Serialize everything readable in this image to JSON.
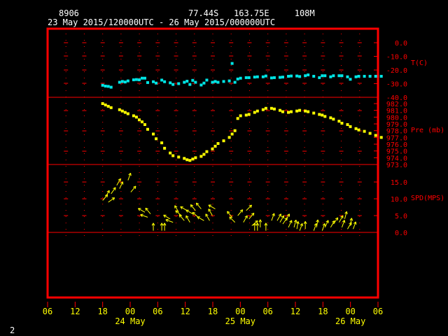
{
  "header": {
    "station_id": "8906",
    "location": "77.44S   163.75E     108M",
    "period": "23 May 2015/120000UTC - 26 May 2015/000000UTC"
  },
  "footer": {
    "page_number": "2"
  },
  "colors": {
    "frame": "#ff0000",
    "text_labels": "#ff0000",
    "header_text": "#ffffff",
    "temperature": "#00e5e5",
    "pressure": "#ffff00",
    "wind": "#ffff00"
  },
  "chart_data": [
    {
      "type": "scatter",
      "name": "temperature",
      "ylabel": "T(C)",
      "ylim": [
        -40,
        10
      ],
      "yticks": [
        0,
        -10,
        -20,
        -30,
        -40
      ],
      "ytick_labels": [
        "0.0",
        "-10.0",
        "-20.0",
        "-30.0",
        "-40.0"
      ],
      "x_hours": [
        0,
        1,
        2,
        3,
        6,
        7,
        8,
        9,
        11,
        12,
        13,
        14,
        15,
        16,
        18,
        19,
        21,
        22,
        24,
        25,
        27,
        29,
        30,
        31,
        32,
        33,
        35,
        36,
        37,
        39,
        40,
        41,
        43,
        45,
        46,
        47,
        48,
        49,
        51,
        52,
        54,
        55,
        57,
        58,
        60,
        61,
        63,
        64,
        66,
        67,
        69,
        70,
        72,
        73,
        75,
        77,
        78,
        79,
        81,
        82,
        84,
        85,
        87,
        88,
        90,
        91,
        93,
        95,
        97,
        99
      ],
      "values": [
        -31.2,
        -31.8,
        -32.0,
        -32.6,
        -29.0,
        -28.4,
        -28.8,
        -28.0,
        -27.2,
        -27.0,
        -27.2,
        -26.0,
        -26.0,
        -29.2,
        -28.6,
        -29.6,
        -27.4,
        -28.6,
        -29.4,
        -30.6,
        -30.0,
        -29.0,
        -28.2,
        -30.6,
        -27.6,
        -29.0,
        -31.0,
        -29.6,
        -27.4,
        -29.0,
        -28.4,
        -29.0,
        -28.4,
        -28.0,
        -15.2,
        -29.0,
        -26.6,
        -26.0,
        -25.6,
        -25.6,
        -25.2,
        -25.0,
        -25.0,
        -24.4,
        -25.8,
        -25.6,
        -25.4,
        -25.2,
        -24.6,
        -24.4,
        -24.4,
        -24.8,
        -24.2,
        -23.6,
        -24.6,
        -25.6,
        -24.2,
        -24.2,
        -25.0,
        -24.2,
        -24.2,
        -24.2,
        -25.0,
        -26.8,
        -25.0,
        -24.6,
        -24.6,
        -24.6,
        -24.6,
        -24.6
      ]
    },
    {
      "type": "scatter",
      "name": "pressure",
      "ylabel": "Pre (mb)",
      "ylim": [
        973,
        982
      ],
      "yticks": [
        982,
        981,
        980,
        979,
        978,
        977,
        976,
        975,
        974,
        973
      ],
      "ytick_labels": [
        "982.0",
        "981.0",
        "980.0",
        "979.0",
        "978.0",
        "977.0",
        "976.0",
        "975.0",
        "974.0",
        "973.0"
      ],
      "x_hours": [
        0,
        1,
        2,
        3,
        6,
        7,
        8,
        9,
        11,
        12,
        13,
        14,
        15,
        16,
        18,
        19,
        21,
        22,
        24,
        25,
        27,
        29,
        30,
        31,
        32,
        33,
        35,
        36,
        37,
        39,
        40,
        41,
        43,
        45,
        46,
        47,
        48,
        49,
        51,
        52,
        54,
        55,
        57,
        58,
        60,
        61,
        63,
        64,
        66,
        67,
        69,
        70,
        72,
        73,
        75,
        77,
        78,
        79,
        81,
        82,
        84,
        85,
        87,
        88,
        90,
        91,
        93,
        95,
        97,
        99
      ],
      "values": [
        982.0,
        981.8,
        981.6,
        981.4,
        981.1,
        980.9,
        980.7,
        980.5,
        980.2,
        980.0,
        979.6,
        979.3,
        978.9,
        978.2,
        977.5,
        976.8,
        976.2,
        975.4,
        974.7,
        974.3,
        974.1,
        973.9,
        973.7,
        973.6,
        973.8,
        974.0,
        974.2,
        974.5,
        974.9,
        975.3,
        975.7,
        976.1,
        976.5,
        977.0,
        977.5,
        978.0,
        979.8,
        980.2,
        980.3,
        980.4,
        980.7,
        980.9,
        981.1,
        981.3,
        981.3,
        981.2,
        981.0,
        980.8,
        980.7,
        980.8,
        980.9,
        981.0,
        980.9,
        980.8,
        980.6,
        980.4,
        980.3,
        980.1,
        979.9,
        979.7,
        979.4,
        979.1,
        978.9,
        978.6,
        978.3,
        978.1,
        977.9,
        977.6,
        977.3,
        977.0
      ]
    },
    {
      "type": "scatter",
      "name": "wind",
      "ylabel": "SPD(MPS)",
      "ylim": [
        0,
        15
      ],
      "yticks": [
        15,
        10,
        5,
        0
      ],
      "ytick_labels": [
        "15.0",
        "10.0",
        "5.0",
        "0.0"
      ],
      "x_hours": [
        0,
        1,
        2,
        3,
        5,
        6,
        9,
        10,
        15,
        16,
        17,
        18,
        21,
        22,
        24,
        25,
        27,
        28,
        29,
        30,
        31,
        32,
        33,
        34,
        35,
        36,
        38,
        39,
        40,
        46,
        47,
        48,
        50,
        51,
        52,
        53,
        54,
        55,
        56,
        58,
        60,
        62,
        63,
        64,
        65,
        66,
        68,
        69,
        70,
        72,
        75,
        76,
        78,
        79,
        81,
        82,
        84,
        85,
        86,
        87,
        88,
        89
      ],
      "speed_mps": [
        9.5,
        10.5,
        9.0,
        11.5,
        14.0,
        13.0,
        15.5,
        12.0,
        6.0,
        4.5,
        5.5,
        0.5,
        0.5,
        0.5,
        4.0,
        3.0,
        6.0,
        5.0,
        3.5,
        6.5,
        3.0,
        5.5,
        6.5,
        4.5,
        7.0,
        3.5,
        3.5,
        5.0,
        7.0,
        4.5,
        3.0,
        5.0,
        3.0,
        6.5,
        4.0,
        2.0,
        0.5,
        0.5,
        1.5,
        0.5,
        3.5,
        3.5,
        3.0,
        2.5,
        3.5,
        1.5,
        1.5,
        1.0,
        0.5,
        1.0,
        0.5,
        1.5,
        0.5,
        1.5,
        1.5,
        2.5,
        3.0,
        1.5,
        4.0,
        1.0,
        2.0,
        1.0
      ],
      "arrow_direction_deg": [
        40,
        30,
        55,
        35,
        30,
        25,
        20,
        40,
        300,
        290,
        320,
        0,
        0,
        0,
        300,
        290,
        330,
        310,
        320,
        300,
        330,
        300,
        320,
        310,
        320,
        300,
        330,
        330,
        300,
        320,
        315,
        40,
        30,
        45,
        40,
        50,
        0,
        0,
        0,
        0,
        20,
        30,
        30,
        35,
        30,
        25,
        15,
        10,
        20,
        0,
        20,
        10,
        20,
        25,
        30,
        35,
        30,
        20,
        15,
        30,
        10,
        20
      ],
      "note": ""
    }
  ],
  "x_axis": {
    "range_hours": [
      -6,
      102
    ],
    "tick_hours": [
      -6,
      0,
      6,
      12,
      18,
      24,
      30,
      36,
      42,
      48,
      54,
      60,
      66,
      72,
      78,
      84,
      90,
      96,
      102
    ],
    "tick_labels": [
      "06",
      "12",
      "18",
      "00",
      "06",
      "12",
      "18",
      "00",
      "06",
      "12",
      "18",
      "00",
      "06"
    ],
    "date_labels": [
      "24 May",
      "25 May",
      "26 May"
    ]
  }
}
